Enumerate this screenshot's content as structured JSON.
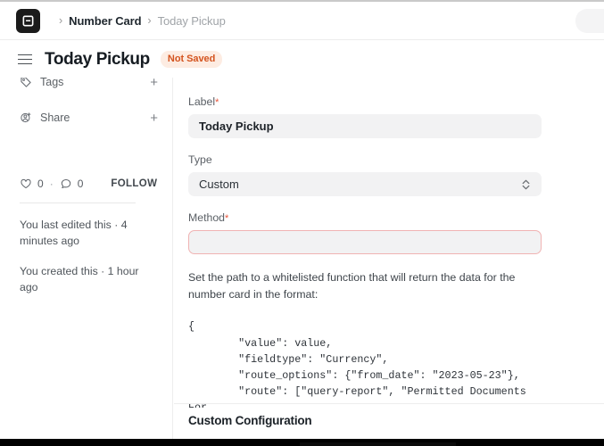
{
  "navbar": {
    "logo_icon": "frappe-logo-icon",
    "breadcrumbs": [
      {
        "label": "Number Card",
        "state": "active"
      },
      {
        "label": "Today Pickup",
        "state": "current"
      }
    ],
    "separator": "›"
  },
  "title_row": {
    "menu_icon": "hamburger-menu-icon",
    "title": "Today Pickup",
    "status_badge": "Not Saved",
    "badge_bg": "#fdece2",
    "badge_fg": "#d4541f"
  },
  "sidebar": {
    "rows": [
      {
        "icon": "tag-icon",
        "label": "Tags",
        "action": "+"
      },
      {
        "icon": "share-user-icon",
        "label": "Share",
        "action": "+"
      }
    ],
    "social": {
      "like_icon": "heart-icon",
      "like_count": "0",
      "separator": "·",
      "comment_icon": "comment-icon",
      "comment_count": "0",
      "follow_label": "FOLLOW"
    },
    "meta": [
      "You last edited this · 4 minutes ago",
      "You created this · 1 hour ago"
    ]
  },
  "form": {
    "fields": [
      {
        "label": "Label",
        "required": "*",
        "value": "Today Pickup",
        "placeholder": "",
        "kind": "text"
      },
      {
        "label": "Type",
        "required": "",
        "value": "Custom",
        "placeholder": "",
        "kind": "select"
      },
      {
        "label": "Method",
        "required": "*",
        "value": "",
        "placeholder": "",
        "kind": "text-error"
      }
    ],
    "help_text": "Set the path to a whitelisted function that will return the data for the number card in the format:",
    "code_sample": "{\n        \"value\": value,\n        \"fieldtype\": \"Currency\",\n        \"route_options\": {\"from_date\": \"2023-05-23\"},\n        \"route\": [\"query-report\", \"Permitted Documents For\nUser\"]\n}"
  },
  "section": {
    "custom_configuration_title": "Custom Configuration"
  },
  "colors": {
    "accent_error": "#e8543a",
    "input_bg": "#f2f2f3",
    "error_border": "#f0b3b3",
    "border": "#ededed"
  }
}
